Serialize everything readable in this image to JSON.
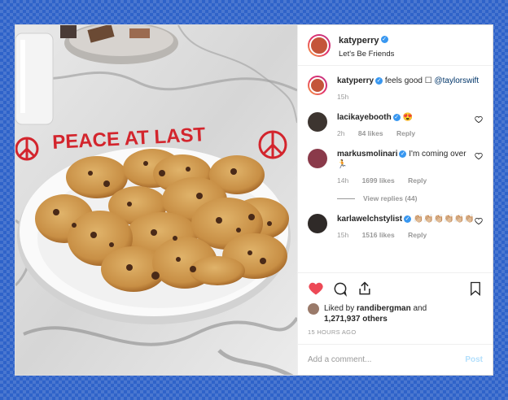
{
  "post": {
    "username": "katyperry",
    "location": "Let's Be Friends",
    "plate_text": "PEACE AT LAST",
    "caption": {
      "username": "katyperry",
      "text": "feels good",
      "emoji": "☐",
      "mention": "@taylorswift",
      "time": "15h"
    }
  },
  "comments": [
    {
      "username": "lacikayebooth",
      "text": "😍",
      "time": "2h",
      "likes": "84 likes",
      "reply": "Reply"
    },
    {
      "username": "markusmolinari",
      "text": "I'm coming over",
      "emoji": "🏃",
      "time": "14h",
      "likes": "1699 likes",
      "reply": "Reply",
      "view_replies": "View replies (44)"
    },
    {
      "username": "karlawelchstylist",
      "text": "👏🏼👏🏼👏🏼👏🏼👏🏼👏🏼",
      "time": "15h",
      "likes": "1516 likes",
      "reply": "Reply"
    }
  ],
  "likes": {
    "prefix": "Liked by",
    "user": "randibergman",
    "and": "and",
    "count": "1,271,937 others"
  },
  "time_ago": "15 HOURS AGO",
  "add_comment": {
    "placeholder": "Add a comment...",
    "post_label": "Post"
  },
  "icons": [
    "heart-icon",
    "comment-icon",
    "share-icon",
    "bookmark-icon",
    "verified-icon"
  ],
  "colors": {
    "accent": "#3897f0",
    "like": "#ed4956",
    "background": "#2f63c9",
    "post_disabled": "#b2dffc"
  }
}
